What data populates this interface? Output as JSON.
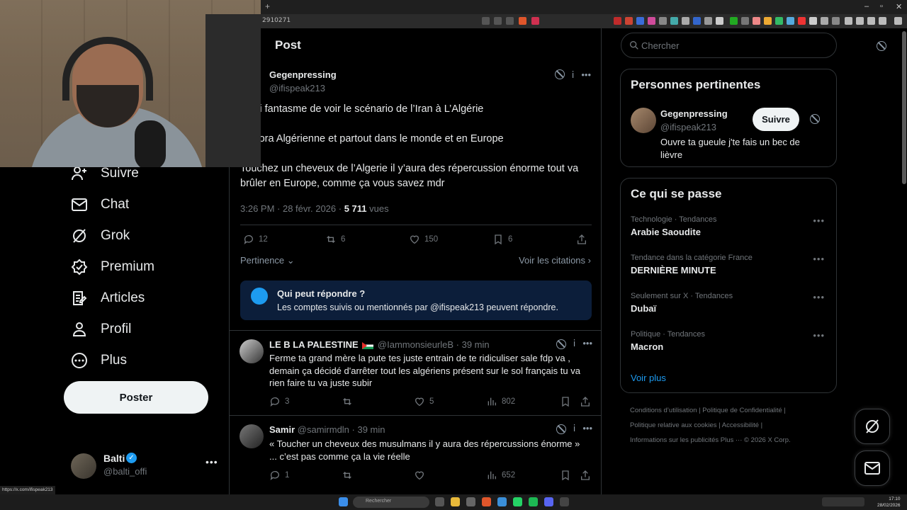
{
  "browser": {
    "url_fragment": "2910271",
    "window_controls": [
      "–",
      "▫",
      "✕"
    ]
  },
  "leftnav": {
    "items": [
      {
        "label": "Suivre",
        "icon": "follow-icon"
      },
      {
        "label": "Chat",
        "icon": "mail-icon"
      },
      {
        "label": "Grok",
        "icon": "grok-icon"
      },
      {
        "label": "Premium",
        "icon": "premium-icon"
      },
      {
        "label": "Articles",
        "icon": "articles-icon"
      },
      {
        "label": "Profil",
        "icon": "profile-icon"
      },
      {
        "label": "Plus",
        "icon": "more-circle-icon"
      }
    ],
    "post_button": "Poster",
    "account": {
      "name": "Balti",
      "handle": "@balti_offi",
      "more": "•••"
    }
  },
  "main": {
    "title": "Post",
    "post": {
      "author": "Gegenpressing",
      "handle": "@ifispeak213",
      "lines": [
        "x qui fantasme de voir le scénario de l’Iran à L’Algérie",
        "iaspora Algérienne et partout dans le monde et en Europe",
        "Touchez un cheveux de l’Algerie il y’aura des répercussion énorme tout va brûler en Europe, comme ça vous savez mdr"
      ],
      "time": "3:26 PM · 28 févr. 2026 ·",
      "views_count": "5 711",
      "views_label": "vues",
      "replies": "12",
      "reposts": "6",
      "likes": "150",
      "bookmarks": "6"
    },
    "sort_label": "Pertinence",
    "quotes_label": "Voir les citations",
    "who_can_reply": {
      "title": "Qui peut répondre ?",
      "text": "Les comptes suivis ou mentionnés par @ifispeak213 peuvent répondre."
    },
    "replies": [
      {
        "name": "LE B LA PALESTINE",
        "handle": "@IammonsieurleB",
        "time": "· 39 min",
        "text": "Ferme ta grand mère la pute tes juste entrain de te ridiculiser sale fdp va , demain ça décidé d'arrêter tout les algériens présent sur le sol français tu va rien faire tu va juste subir",
        "replies": "3",
        "reposts": "",
        "likes": "5",
        "views": "802"
      },
      {
        "name": "Samir",
        "handle": "@samirmdln",
        "time": "· 39 min",
        "text": "« Toucher un cheveux des musulmans il y aura des répercussions énorme » ... c’est pas comme ça la vie réelle",
        "replies": "1",
        "reposts": "",
        "likes": "",
        "views": "652"
      }
    ]
  },
  "right": {
    "search_placeholder": "Chercher",
    "relevant": {
      "title": "Personnes pertinentes",
      "name": "Gegenpressing",
      "handle": "@ifispeak213",
      "bio": "Ouvre ta gueule j'te fais un bec de lièvre",
      "follow": "Suivre"
    },
    "trends": {
      "title": "Ce qui se passe",
      "items": [
        {
          "category": "Technologie · Tendances",
          "topic": "Arabie Saoudite"
        },
        {
          "category": "Tendance dans la catégorie France",
          "topic": "DERNIÈRE MINUTE"
        },
        {
          "category": "Seulement sur X · Tendances",
          "topic": "Dubaï"
        },
        {
          "category": "Politique · Tendances",
          "topic": "Macron"
        }
      ],
      "more": "Voir plus"
    },
    "footer": {
      "line1": "Conditions d’utilisation  |   Politique de Confidentialité  |",
      "line2": "Politique relative aux cookies  |   Accessibilité  |",
      "line3": "Informations sur les publicités   Plus ···   © 2026 X Corp."
    }
  },
  "status_url": "https://x.com/ifispeak213",
  "taskbar": {
    "search": "Rechercher",
    "time": "17:10",
    "date": "28/02/2026"
  },
  "colors": {
    "background": "#000000",
    "accent": "#1d9bf0",
    "border": "#2f3336",
    "muted": "#71767b"
  }
}
